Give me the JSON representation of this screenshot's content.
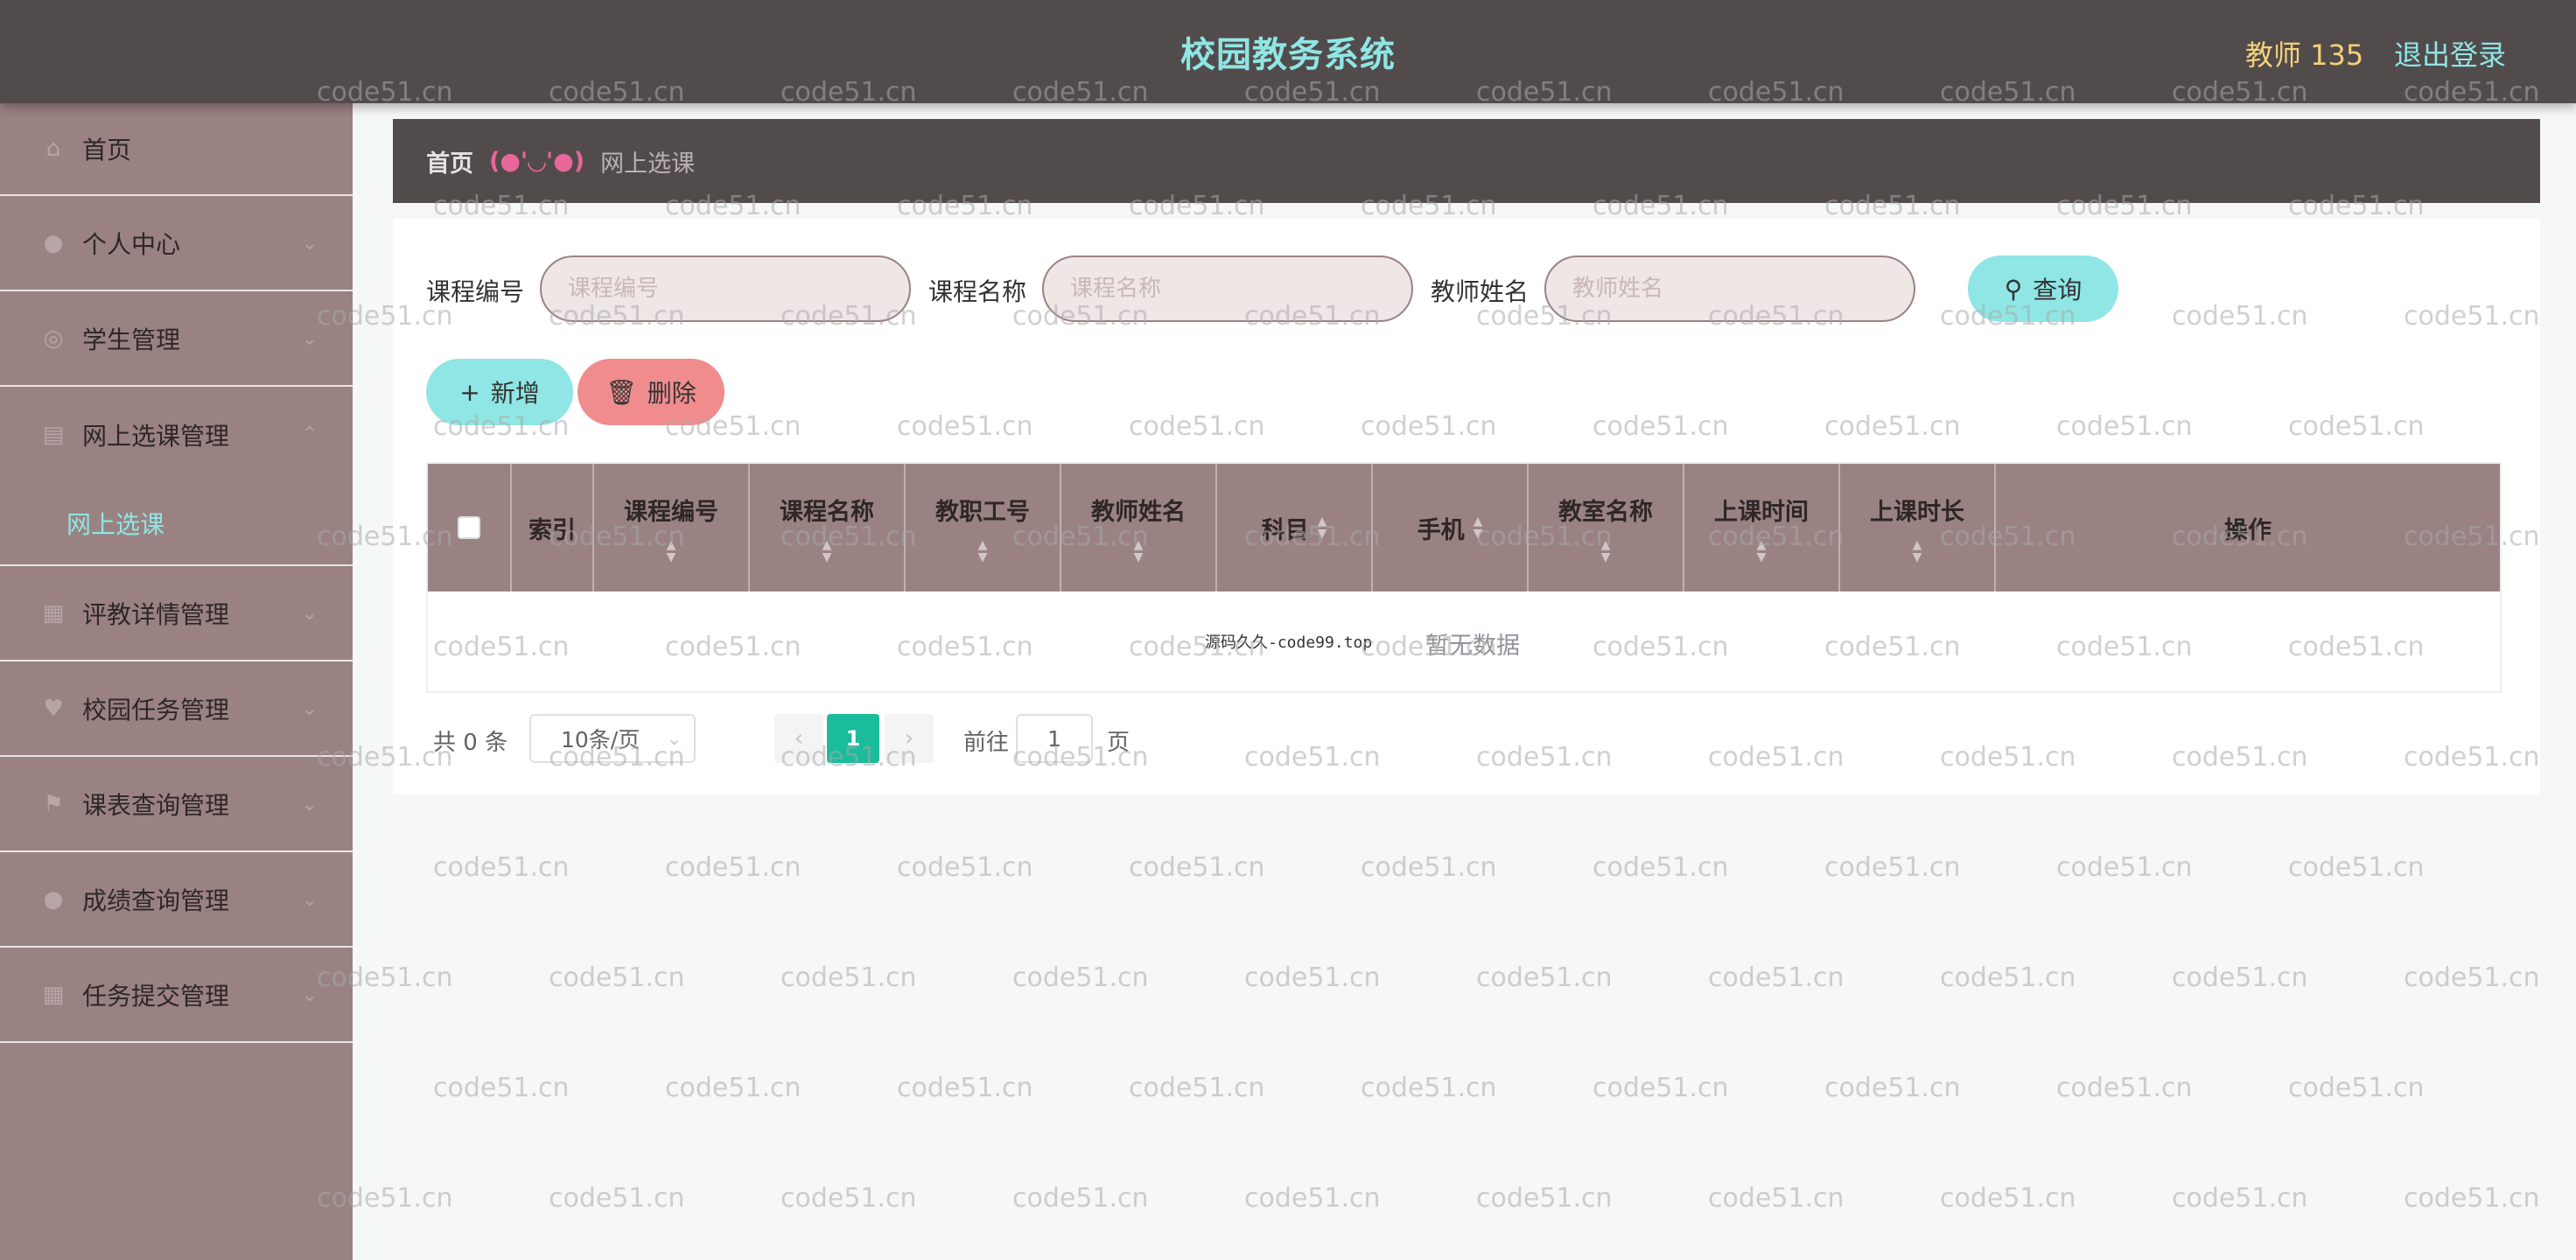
{
  "header": {
    "title": "校园教务系统",
    "user": "教师 135",
    "logout": "退出登录"
  },
  "sidebar": {
    "items": [
      {
        "label": "首页",
        "icon": "home-icon"
      },
      {
        "label": "个人中心",
        "icon": "user-icon"
      },
      {
        "label": "学生管理",
        "icon": "student-icon"
      },
      {
        "label": "网上选课管理",
        "icon": "course-icon"
      },
      {
        "label": "评教详情管理",
        "icon": "evaluation-icon"
      },
      {
        "label": "校园任务管理",
        "icon": "task-icon"
      },
      {
        "label": "课表查询管理",
        "icon": "flag-icon"
      },
      {
        "label": "成绩查询管理",
        "icon": "score-icon"
      },
      {
        "label": "任务提交管理",
        "icon": "grid-icon"
      }
    ],
    "submenu": {
      "label": "网上选课"
    }
  },
  "breadcrumb": {
    "home": "首页",
    "separator": "(●'◡'●)",
    "current": "网上选课"
  },
  "search": {
    "course_no_label": "课程编号",
    "course_no_placeholder": "课程编号",
    "course_name_label": "课程名称",
    "course_name_placeholder": "课程名称",
    "teacher_name_label": "教师姓名",
    "teacher_name_placeholder": "教师姓名",
    "query_label": "查询"
  },
  "actions": {
    "add_label": "新增",
    "delete_label": "删除"
  },
  "table": {
    "columns": [
      "索引",
      "课程编号",
      "课程名称",
      "教职工号",
      "教师姓名",
      "科目",
      "手机",
      "教室名称",
      "上课时间",
      "上课时长",
      "操作"
    ],
    "empty_text": "暂无数据",
    "overlay_text": "源码久久-code99.top"
  },
  "pagination": {
    "total": "共 0 条",
    "page_size": "10条/页",
    "current_page": "1",
    "goto_label": "前往",
    "goto_value": "1",
    "page_suffix": "页"
  },
  "watermark": {
    "text": "code51.cn"
  },
  "colors": {
    "header_bg": "#524b4c",
    "sidebar_bg": "#9a8283",
    "accent": "#8fe6e4",
    "delete": "#f08c8d",
    "active_page": "#1abc9c"
  }
}
